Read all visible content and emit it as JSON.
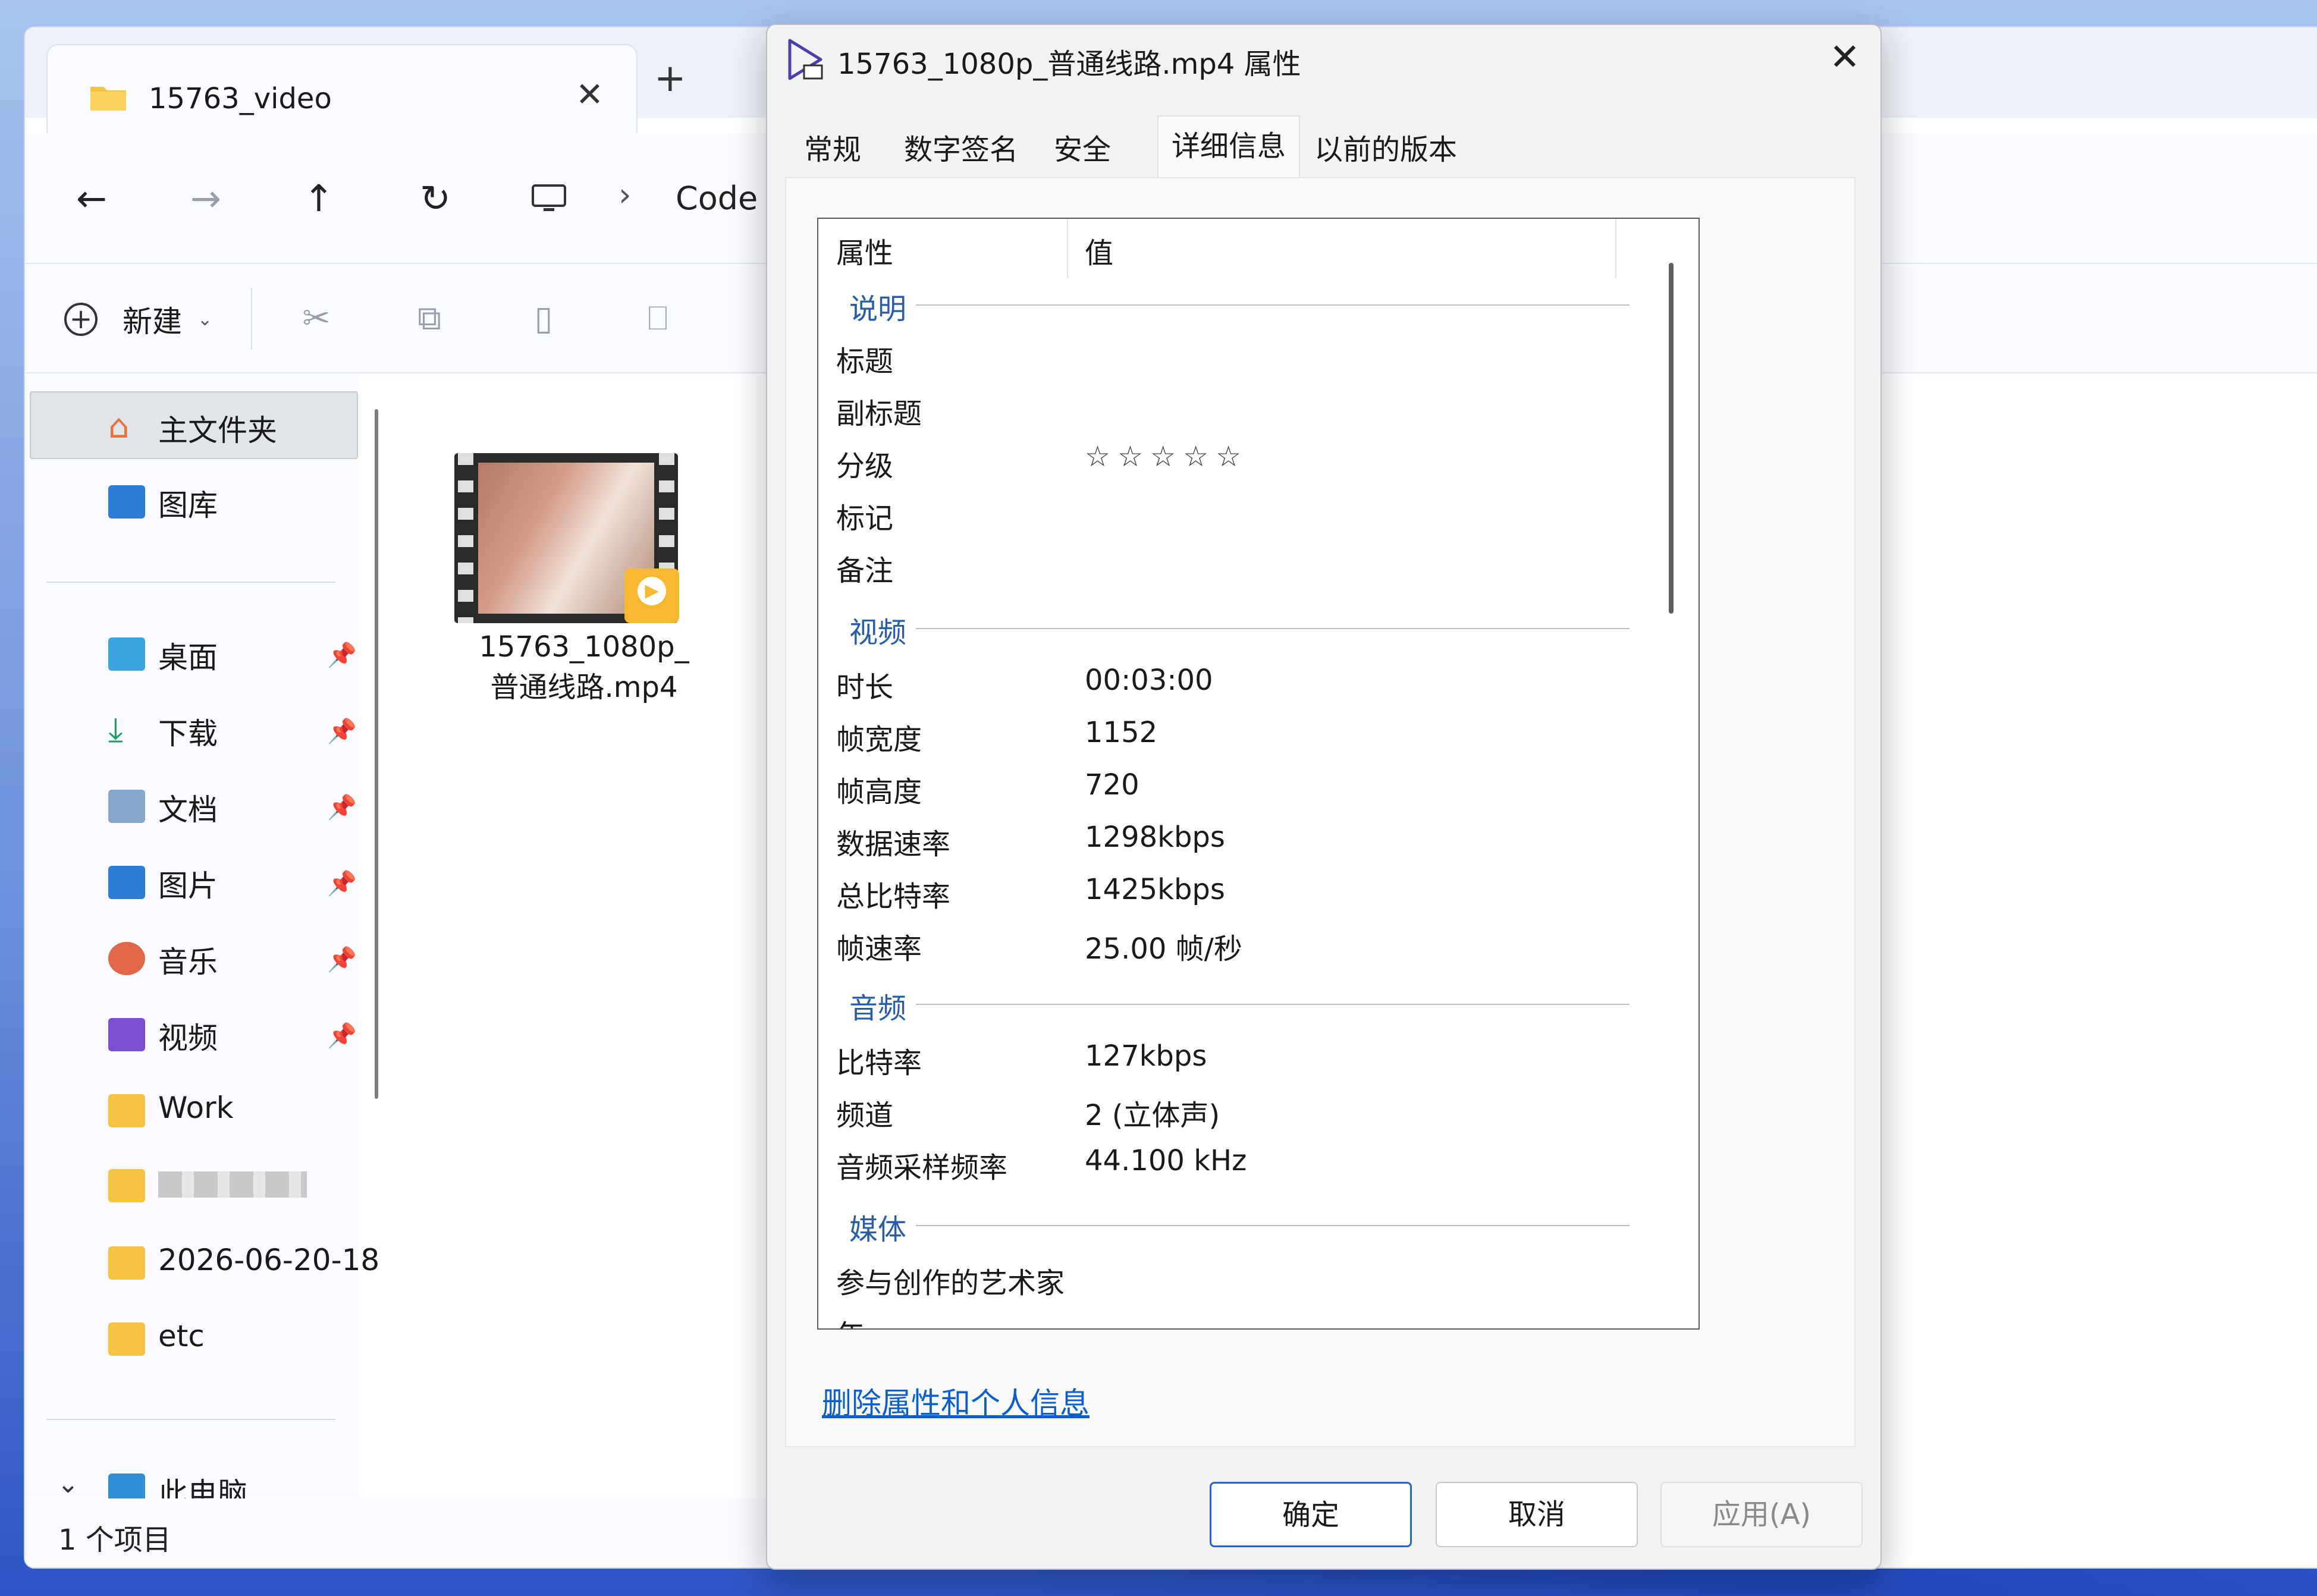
{
  "explorer": {
    "tab_title": "15763_video",
    "tab_close": "✕",
    "tab_add": "+",
    "nav": {
      "back": "←",
      "forward": "→",
      "up": "↑",
      "refresh": "↻",
      "separator": "›",
      "breadcrumb": "Code"
    },
    "toolbar": {
      "new_label": "新建",
      "new_caret": "⌄"
    },
    "sidebar": {
      "home": "主文件夹",
      "gallery": "图库",
      "desktop": "桌面",
      "downloads": "下载",
      "documents": "文档",
      "pictures": "图片",
      "music": "音乐",
      "videos": "视频",
      "work": "Work",
      "dated_folder": "2026-06-20-18",
      "etc": "etc",
      "this_pc": "此电脑",
      "expand_caret": "⌄"
    },
    "file": {
      "name_line1": "15763_1080p_",
      "name_line2": "普通线路.mp4"
    },
    "status": "1 个项目"
  },
  "dialog": {
    "title": "15763_1080p_普通线路.mp4 属性",
    "close": "✕",
    "tabs": [
      "常规",
      "数字签名",
      "安全",
      "详细信息",
      "以前的版本"
    ],
    "active_tab": "详细信息",
    "list_headers": {
      "property": "属性",
      "value": "值"
    },
    "groups": {
      "description": "说明",
      "video": "视频",
      "audio": "音频",
      "media": "媒体"
    },
    "description_rows": [
      {
        "k": "标题",
        "v": ""
      },
      {
        "k": "副标题",
        "v": ""
      },
      {
        "k": "分级",
        "v": "☆☆☆☆☆"
      },
      {
        "k": "标记",
        "v": ""
      },
      {
        "k": "备注",
        "v": ""
      }
    ],
    "video_rows": [
      {
        "k": "时长",
        "v": "00:03:00"
      },
      {
        "k": "帧宽度",
        "v": "1152"
      },
      {
        "k": "帧高度",
        "v": "720"
      },
      {
        "k": "数据速率",
        "v": "1298kbps"
      },
      {
        "k": "总比特率",
        "v": "1425kbps"
      },
      {
        "k": "帧速率",
        "v": "25.00 帧/秒"
      }
    ],
    "audio_rows": [
      {
        "k": "比特率",
        "v": "127kbps"
      },
      {
        "k": "频道",
        "v": "2 (立体声)"
      },
      {
        "k": "音频采样频率",
        "v": "44.100 kHz"
      }
    ],
    "media_rows": [
      {
        "k": "参与创作的艺术家",
        "v": ""
      },
      {
        "k": "年",
        "v": ""
      }
    ],
    "remove_link": "删除属性和个人信息",
    "buttons": {
      "ok": "确定",
      "cancel": "取消",
      "apply": "应用(A)"
    }
  },
  "colors": {
    "accent": "#2a63c8",
    "link": "#0a5fd0",
    "group_header": "#2a5da8",
    "folder": "#f6c445"
  }
}
